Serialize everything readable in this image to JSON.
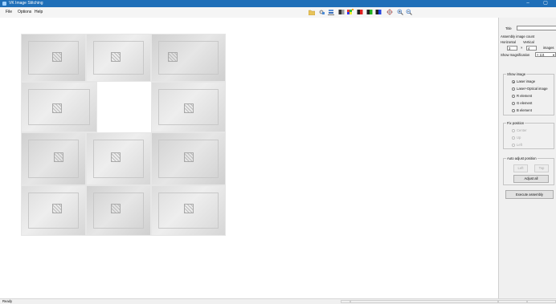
{
  "window": {
    "title": "VK Image Stitching",
    "minimize_glyph": "–",
    "maximize_glyph": "▢"
  },
  "menu": {
    "file": "File",
    "options": "Options",
    "help": "Help"
  },
  "toolbar": {
    "icons": [
      "open-folder-icon",
      "settings-icon",
      "stack-icon",
      "grayscale-icon",
      "color-icon",
      "red-icon",
      "green-icon",
      "blue-icon",
      "crosshair-icon",
      "zoom-in-icon",
      "zoom-out-icon"
    ]
  },
  "panel": {
    "title_label": "Title",
    "title_value": "",
    "count_label": "Assembly image count",
    "horizontal_label": "Horizontal",
    "vertical_label": "Vertical",
    "horizontal_value": "3",
    "times": "×",
    "vertical_value": "4",
    "images_label": "images",
    "magnification_label": "Show magnification",
    "magnification_value": "× 1/4",
    "show_image": {
      "legend": "Show image",
      "options": [
        "Laser image",
        "Laser+Optical image",
        "R element",
        "G element",
        "B element"
      ],
      "selected": 0
    },
    "fix_position": {
      "legend": "Fix position",
      "options": [
        "Center",
        "Up",
        "Left"
      ]
    },
    "auto_adjust": {
      "legend": "Auto adjust position",
      "left_button": "Left",
      "top_button": "Top",
      "adjust_all": "Adjust all"
    },
    "execute": "Execute assembly"
  },
  "status": {
    "text": "Ready"
  },
  "colors": {
    "titlebar": "#1f6fb8",
    "panel_bg": "#f0f0f0"
  }
}
